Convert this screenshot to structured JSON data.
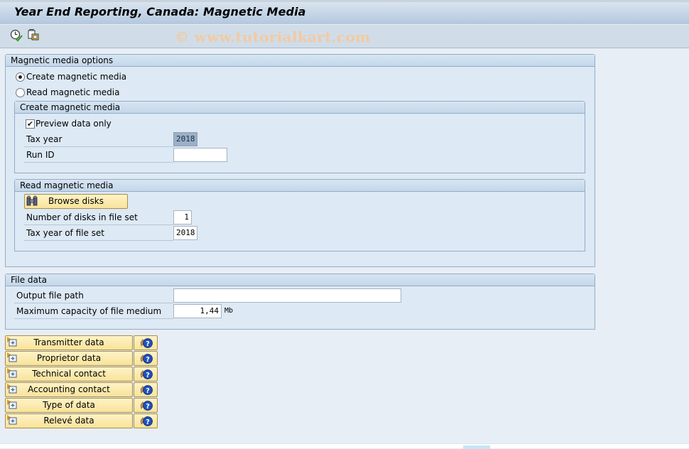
{
  "window": {
    "title": "Year End Reporting, Canada: Magnetic Media",
    "watermark": "© www.tutorialkart.com"
  },
  "toolbar": {
    "icons": [
      "execute-clock-icon",
      "get-variant-icon"
    ]
  },
  "magnetic_media_options": {
    "header": "Magnetic media options",
    "radio_create": {
      "label": "Create magnetic media",
      "selected": true
    },
    "radio_read": {
      "label": "Read magnetic media",
      "selected": false
    },
    "create_group": {
      "header": "Create magnetic media",
      "preview_checkbox": {
        "label": "Preview data only",
        "checked": true
      },
      "tax_year": {
        "label": "Tax year",
        "value": "2018"
      },
      "run_id": {
        "label": "Run ID",
        "value": ""
      }
    },
    "read_group": {
      "header": "Read magnetic media",
      "browse_button": "Browse disks",
      "num_disks": {
        "label": "Number of disks in file set",
        "value": "1"
      },
      "tax_year_set": {
        "label": "Tax year of file set",
        "value": "2018"
      }
    }
  },
  "file_data": {
    "header": "File data",
    "output_path": {
      "label": "Output file path",
      "value": ""
    },
    "max_capacity": {
      "label": "Maximum capacity of file medium",
      "value": "1,44",
      "unit": "Mb"
    }
  },
  "data_buttons": [
    {
      "label": "Transmitter data"
    },
    {
      "label": "Proprietor data"
    },
    {
      "label": "Technical contact"
    },
    {
      "label": "Accounting contact"
    },
    {
      "label": "Type of data"
    },
    {
      "label": "Relevé data"
    }
  ]
}
